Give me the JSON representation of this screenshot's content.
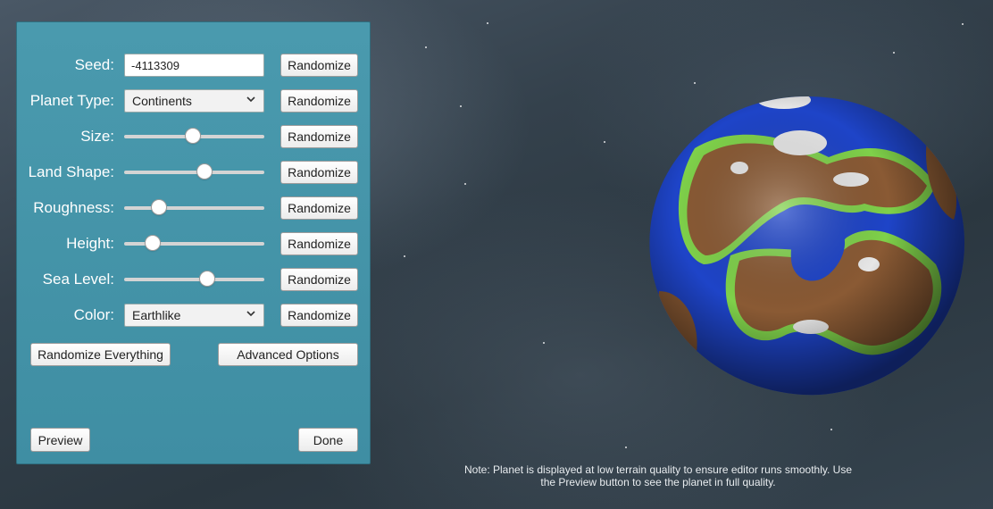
{
  "panel": {
    "rows": [
      {
        "label": "Seed:",
        "control": "text",
        "value": "-4113309",
        "button": "Randomize"
      },
      {
        "label": "Planet Type:",
        "control": "select",
        "value": "Continents",
        "button": "Randomize"
      },
      {
        "label": "Size:",
        "control": "slider",
        "value": 0.49,
        "button": "Randomize"
      },
      {
        "label": "Land Shape:",
        "control": "slider",
        "value": 0.58,
        "button": "Randomize"
      },
      {
        "label": "Roughness:",
        "control": "slider",
        "value": 0.22,
        "button": "Randomize"
      },
      {
        "label": "Height:",
        "control": "slider",
        "value": 0.17,
        "button": "Randomize"
      },
      {
        "label": "Sea Level:",
        "control": "slider",
        "value": 0.6,
        "button": "Randomize"
      },
      {
        "label": "Color:",
        "control": "select",
        "value": "Earthlike",
        "button": "Randomize"
      }
    ],
    "randomize_everything": "Randomize Everything",
    "advanced_options": "Advanced Options",
    "preview": "Preview",
    "done": "Done"
  },
  "note": "Note: Planet is displayed at low terrain quality to ensure editor runs smoothly. Use the Preview button to see the planet in full quality.",
  "planet": {
    "ocean_color": "#1e44c8",
    "land_color": "#8a5a34",
    "coast_color": "#7fd14a",
    "snow_color": "#e6e6e6"
  },
  "icons": {
    "select_chevron": "chevron-down-icon"
  }
}
